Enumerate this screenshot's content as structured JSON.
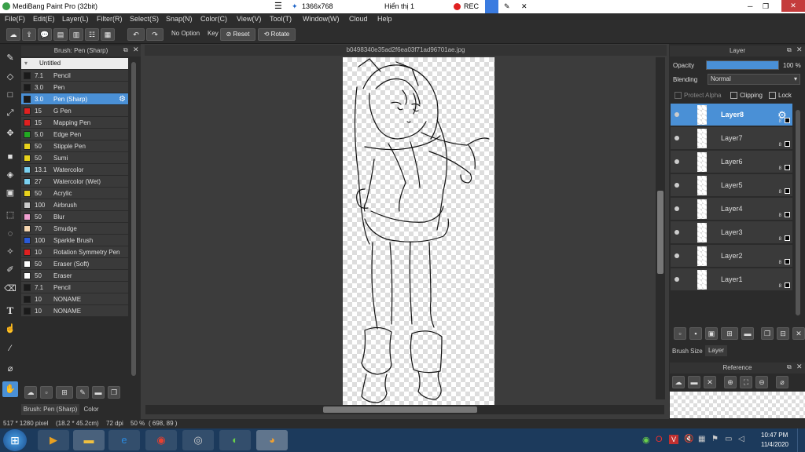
{
  "titlebar": {
    "app_title": "MediBang Paint Pro (32bit)",
    "resolution": "1366x768",
    "display": "Hiển thị 1",
    "rec": "REC"
  },
  "menu": [
    "File(F)",
    "Edit(E)",
    "Layer(L)",
    "Filter(R)",
    "Select(S)",
    "Snap(N)",
    "Color(C)",
    "View(V)",
    "Tool(T)",
    "Window(W)",
    "Cloud",
    "Help"
  ],
  "toolbar": {
    "no_option": "No Option",
    "key": "Key",
    "reset": "Reset",
    "rotate": "Rotate"
  },
  "brush_panel": {
    "title": "Brush: Pen (Sharp)",
    "group": "Untitled",
    "items": [
      {
        "size": "7.1",
        "name": "Pencil",
        "color": "#1a1a1a"
      },
      {
        "size": "3.0",
        "name": "Pen",
        "color": "#1a1a1a"
      },
      {
        "size": "3.0",
        "name": "Pen (Sharp)",
        "color": "#1a1a1a",
        "selected": true
      },
      {
        "size": "15",
        "name": "G Pen",
        "color": "#e02020"
      },
      {
        "size": "15",
        "name": "Mapping Pen",
        "color": "#e02020"
      },
      {
        "size": "5.0",
        "name": "Edge Pen",
        "color": "#22aa22"
      },
      {
        "size": "50",
        "name": "Stipple Pen",
        "color": "#e8d21c"
      },
      {
        "size": "50",
        "name": "Sumi",
        "color": "#e8d21c"
      },
      {
        "size": "13.1",
        "name": "Watercolor",
        "color": "#7ad0f0"
      },
      {
        "size": "27",
        "name": "Watercolor (Wet)",
        "color": "#7ad0f0"
      },
      {
        "size": "50",
        "name": "Acrylic",
        "color": "#e8d21c"
      },
      {
        "size": "100",
        "name": "Airbrush",
        "color": "#cccccc"
      },
      {
        "size": "50",
        "name": "Blur",
        "color": "#f0a0d0"
      },
      {
        "size": "70",
        "name": "Smudge",
        "color": "#f5d6b0"
      },
      {
        "size": "100",
        "name": "Sparkle Brush",
        "color": "#2a5ad8"
      },
      {
        "size": "10",
        "name": "Rotation Symmetry Pen",
        "color": "#e02020"
      },
      {
        "size": "50",
        "name": "Eraser (Soft)",
        "color": "#ffffff"
      },
      {
        "size": "50",
        "name": "Eraser",
        "color": "#ffffff"
      },
      {
        "size": "7.1",
        "name": "Pencil",
        "color": "#1a1a1a"
      },
      {
        "size": "10",
        "name": "NONAME",
        "color": "#1a1a1a"
      },
      {
        "size": "10",
        "name": "NONAME",
        "color": "#1a1a1a"
      }
    ],
    "tab_brush": "Brush: Pen (Sharp)",
    "tab_color": "Color"
  },
  "canvas": {
    "tab_title": "b0498340e35ad2f6ea03f71ad96701ae.jpg"
  },
  "layer_panel": {
    "title": "Layer",
    "opacity_label": "Opacity",
    "opacity_value": "100 %",
    "opacity_fraction": 1.0,
    "blending_label": "Blending",
    "blending_value": "Normal",
    "protect_alpha": "Protect Alpha",
    "clipping": "Clipping",
    "lock": "Lock",
    "layers": [
      {
        "name": "Layer8",
        "bit": "8",
        "selected": true
      },
      {
        "name": "Layer7",
        "bit": "8"
      },
      {
        "name": "Layer6",
        "bit": "8"
      },
      {
        "name": "Layer5",
        "bit": "8"
      },
      {
        "name": "Layer4",
        "bit": "8"
      },
      {
        "name": "Layer3",
        "bit": "8"
      },
      {
        "name": "Layer2",
        "bit": "8"
      },
      {
        "name": "Layer1",
        "bit": "8"
      }
    ],
    "tab_brush_size": "Brush Size",
    "tab_layer": "Layer"
  },
  "reference_panel": {
    "title": "Reference"
  },
  "status": {
    "size": "517 * 1280 pixel",
    "cm": "(18.2 * 45.2cm)",
    "dpi": "72 dpi",
    "zoom": "50 %",
    "coords": "( 698, 89 )"
  },
  "taskbar": {
    "time": "10:47 PM",
    "date": "11/4/2020"
  }
}
